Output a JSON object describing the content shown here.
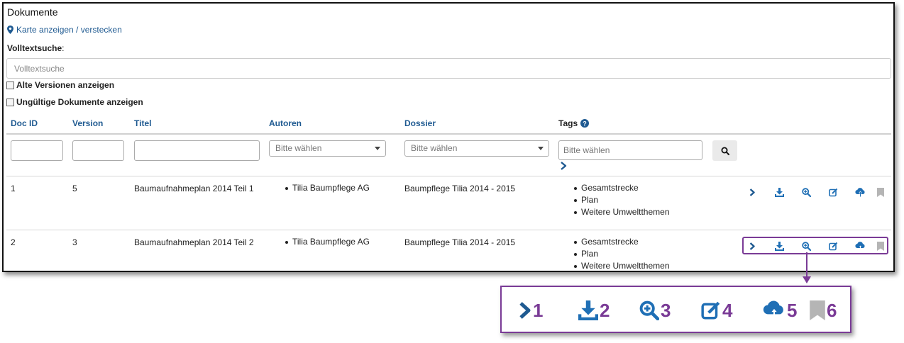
{
  "panel": {
    "title": "Dokumente",
    "map_link": "Karte anzeigen / verstecken",
    "fulltext_label": "Volltextsuche",
    "fulltext_colon": ":",
    "fulltext_placeholder": "Volltextsuche",
    "checkbox_old_versions": "Alte Versionen anzeigen",
    "checkbox_invalid_docs": "Ungültige Dokumente anzeigen"
  },
  "table": {
    "headers": {
      "doc_id": "Doc ID",
      "version": "Version",
      "titel": "Titel",
      "autoren": "Autoren",
      "dossier": "Dossier",
      "tags": "Tags"
    },
    "filters": {
      "autoren_placeholder": "Bitte wählen",
      "dossier_placeholder": "Bitte wählen",
      "tags_placeholder": "Bitte wählen"
    },
    "rows": [
      {
        "doc_id": "1",
        "version": "5",
        "titel": "Baumaufnahmeplan 2014 Teil 1",
        "autor": "Tilia Baumpflege AG",
        "dossier": "Baumpflege Tilia 2014 - 2015",
        "tags": [
          "Gesamtstrecke",
          "Plan",
          "Weitere Umweltthemen"
        ]
      },
      {
        "doc_id": "2",
        "version": "3",
        "titel": "Baumaufnahmeplan 2014 Teil 2",
        "autor": "Tilia Baumpflege AG",
        "dossier": "Baumpflege Tilia 2014 - 2015",
        "tags": [
          "Gesamtstrecke",
          "Plan",
          "Weitere Umweltthemen"
        ]
      }
    ]
  },
  "legend": {
    "items": [
      {
        "icon": "chevron-right-icon",
        "number": "1"
      },
      {
        "icon": "download-icon",
        "number": "2"
      },
      {
        "icon": "zoom-in-icon",
        "number": "3"
      },
      {
        "icon": "edit-icon",
        "number": "4"
      },
      {
        "icon": "cloud-upload-icon",
        "number": "5"
      },
      {
        "icon": "bookmark-icon",
        "number": "6"
      }
    ]
  },
  "colors": {
    "link_blue": "#1f5a91",
    "icon_blue": "#1f6fb5",
    "annotation_purple": "#7a3b96",
    "bookmark_gray": "#b5b5b5"
  }
}
